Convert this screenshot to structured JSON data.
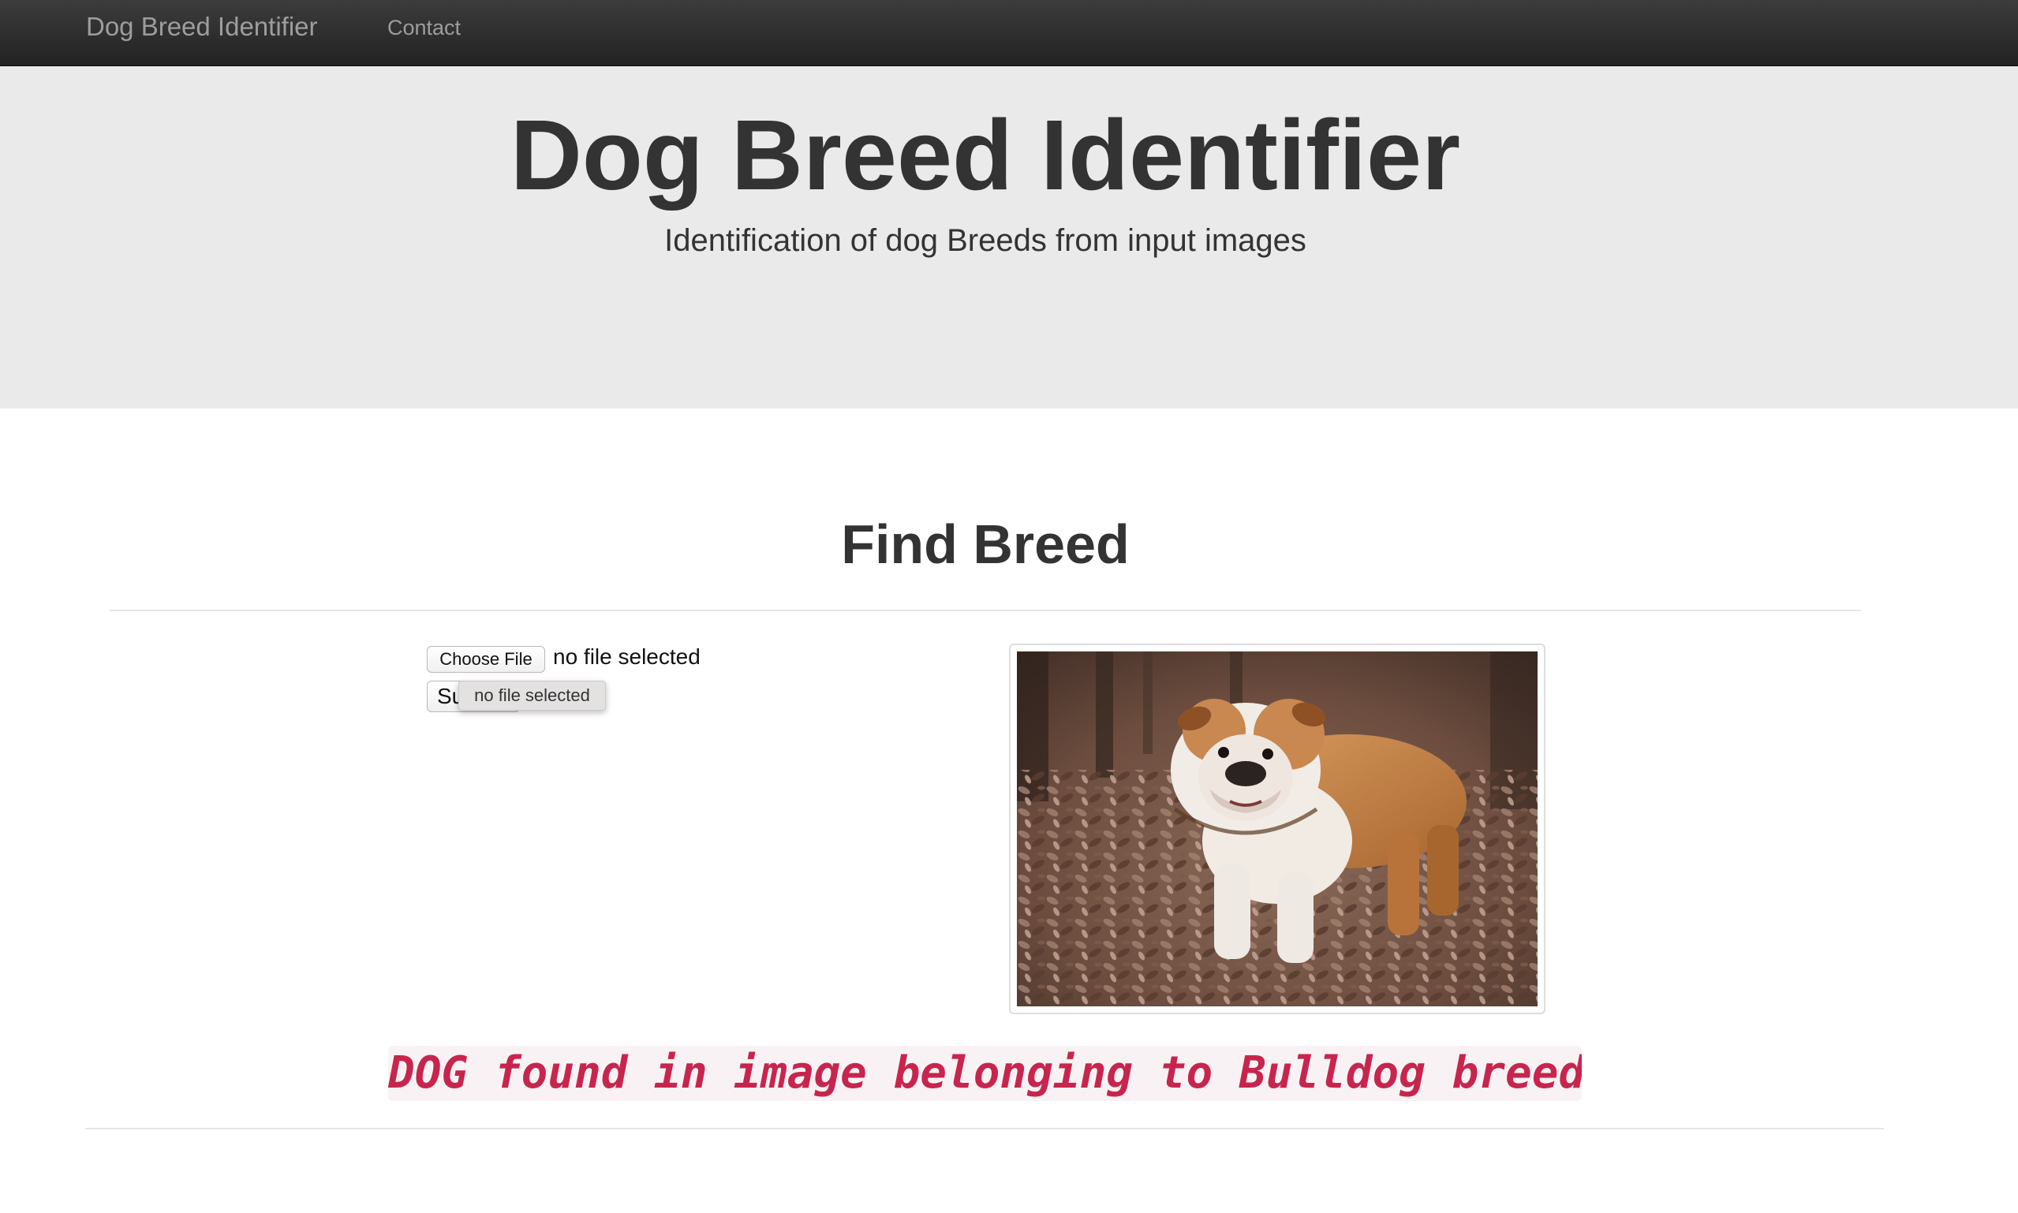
{
  "navbar": {
    "brand": "Dog Breed Identifier",
    "links": [
      "Contact"
    ]
  },
  "jumbotron": {
    "title": "Dog Breed Identifier",
    "subtitle": "Identification of dog Breeds from input images"
  },
  "main": {
    "section_title": "Find Breed",
    "upload": {
      "choose_label": "Choose File",
      "file_status": "no file selected",
      "submit_label": "Submit",
      "tooltip": "no file selected"
    },
    "preview_image": {
      "icon": "bulldog-photo"
    },
    "result": "DOG found in image belonging to Bulldog breed!"
  },
  "colors": {
    "navbar": "#222222",
    "navbar_text": "#9d9d9d",
    "jumbotron": "#eaeaea",
    "result_text": "#c7254e",
    "result_bg": "#f9f2f4"
  }
}
